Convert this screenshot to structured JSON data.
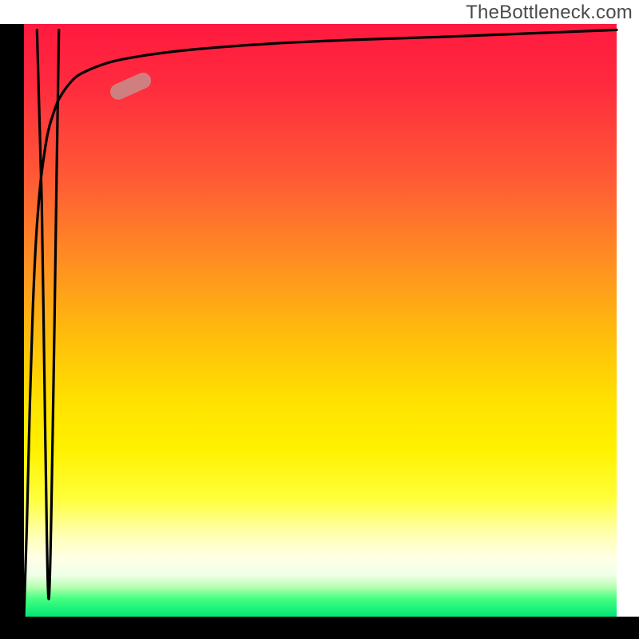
{
  "attribution": "TheBottleneck.com",
  "colors": {
    "curve": "#000000",
    "marker_fill": "#cf7f7f"
  },
  "chart_data": {
    "type": "line",
    "title": "",
    "xlabel": "",
    "ylabel": "",
    "xlim": [
      0,
      100
    ],
    "ylim": [
      0,
      100
    ],
    "grid": false,
    "legend": false,
    "background_gradient": {
      "stops": [
        {
          "pos": 0.0,
          "color": "#ff1a3f"
        },
        {
          "pos": 0.1,
          "color": "#ff2a3e"
        },
        {
          "pos": 0.26,
          "color": "#ff5a35"
        },
        {
          "pos": 0.4,
          "color": "#ff8e22"
        },
        {
          "pos": 0.54,
          "color": "#ffc20a"
        },
        {
          "pos": 0.64,
          "color": "#ffe200"
        },
        {
          "pos": 0.72,
          "color": "#fff200"
        },
        {
          "pos": 0.8,
          "color": "#ffff3a"
        },
        {
          "pos": 0.86,
          "color": "#ffffb0"
        },
        {
          "pos": 0.9,
          "color": "#ffffe5"
        },
        {
          "pos": 0.93,
          "color": "#f0ffe8"
        },
        {
          "pos": 0.95,
          "color": "#b6ffb0"
        },
        {
          "pos": 0.97,
          "color": "#44ff80"
        },
        {
          "pos": 1.0,
          "color": "#00e676"
        }
      ]
    },
    "series": [
      {
        "name": "main-curve",
        "x": [
          0.0,
          0.5,
          1.0,
          1.5,
          2.0,
          2.5,
          3.0,
          4.0,
          5.0,
          6.0,
          8.0,
          10.0,
          14.0,
          18.0,
          24.0,
          32.0,
          42.0,
          55.0,
          70.0,
          85.0,
          100.0
        ],
        "y": [
          0.0,
          16.0,
          36.0,
          52.0,
          63.0,
          70.0,
          75.0,
          81.5,
          85.0,
          87.5,
          90.3,
          91.8,
          93.4,
          94.3,
          95.2,
          96.0,
          96.7,
          97.3,
          97.8,
          98.4,
          99.0
        ]
      },
      {
        "name": "left-dip",
        "x": [
          2.2,
          3.0,
          3.6,
          4.2,
          4.9,
          5.5,
          5.9
        ],
        "y": [
          99.0,
          70.0,
          30.0,
          3.0,
          34.0,
          74.0,
          99.0
        ]
      }
    ],
    "marker": {
      "on_series": "main-curve",
      "approx_x": 18.0,
      "approx_y": 89.5,
      "shape": "rounded-pill",
      "angle_deg": -24
    }
  }
}
